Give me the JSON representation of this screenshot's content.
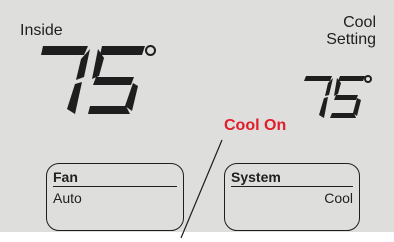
{
  "inside": {
    "label": "Inside",
    "temperature": "75"
  },
  "setting": {
    "label_line1": "Cool",
    "label_line2": "Setting",
    "temperature": "75"
  },
  "status": {
    "text": "Cool On",
    "color": "#e11d2a"
  },
  "fan": {
    "title": "Fan",
    "value": "Auto"
  },
  "system": {
    "title": "System",
    "value": "Cool"
  }
}
